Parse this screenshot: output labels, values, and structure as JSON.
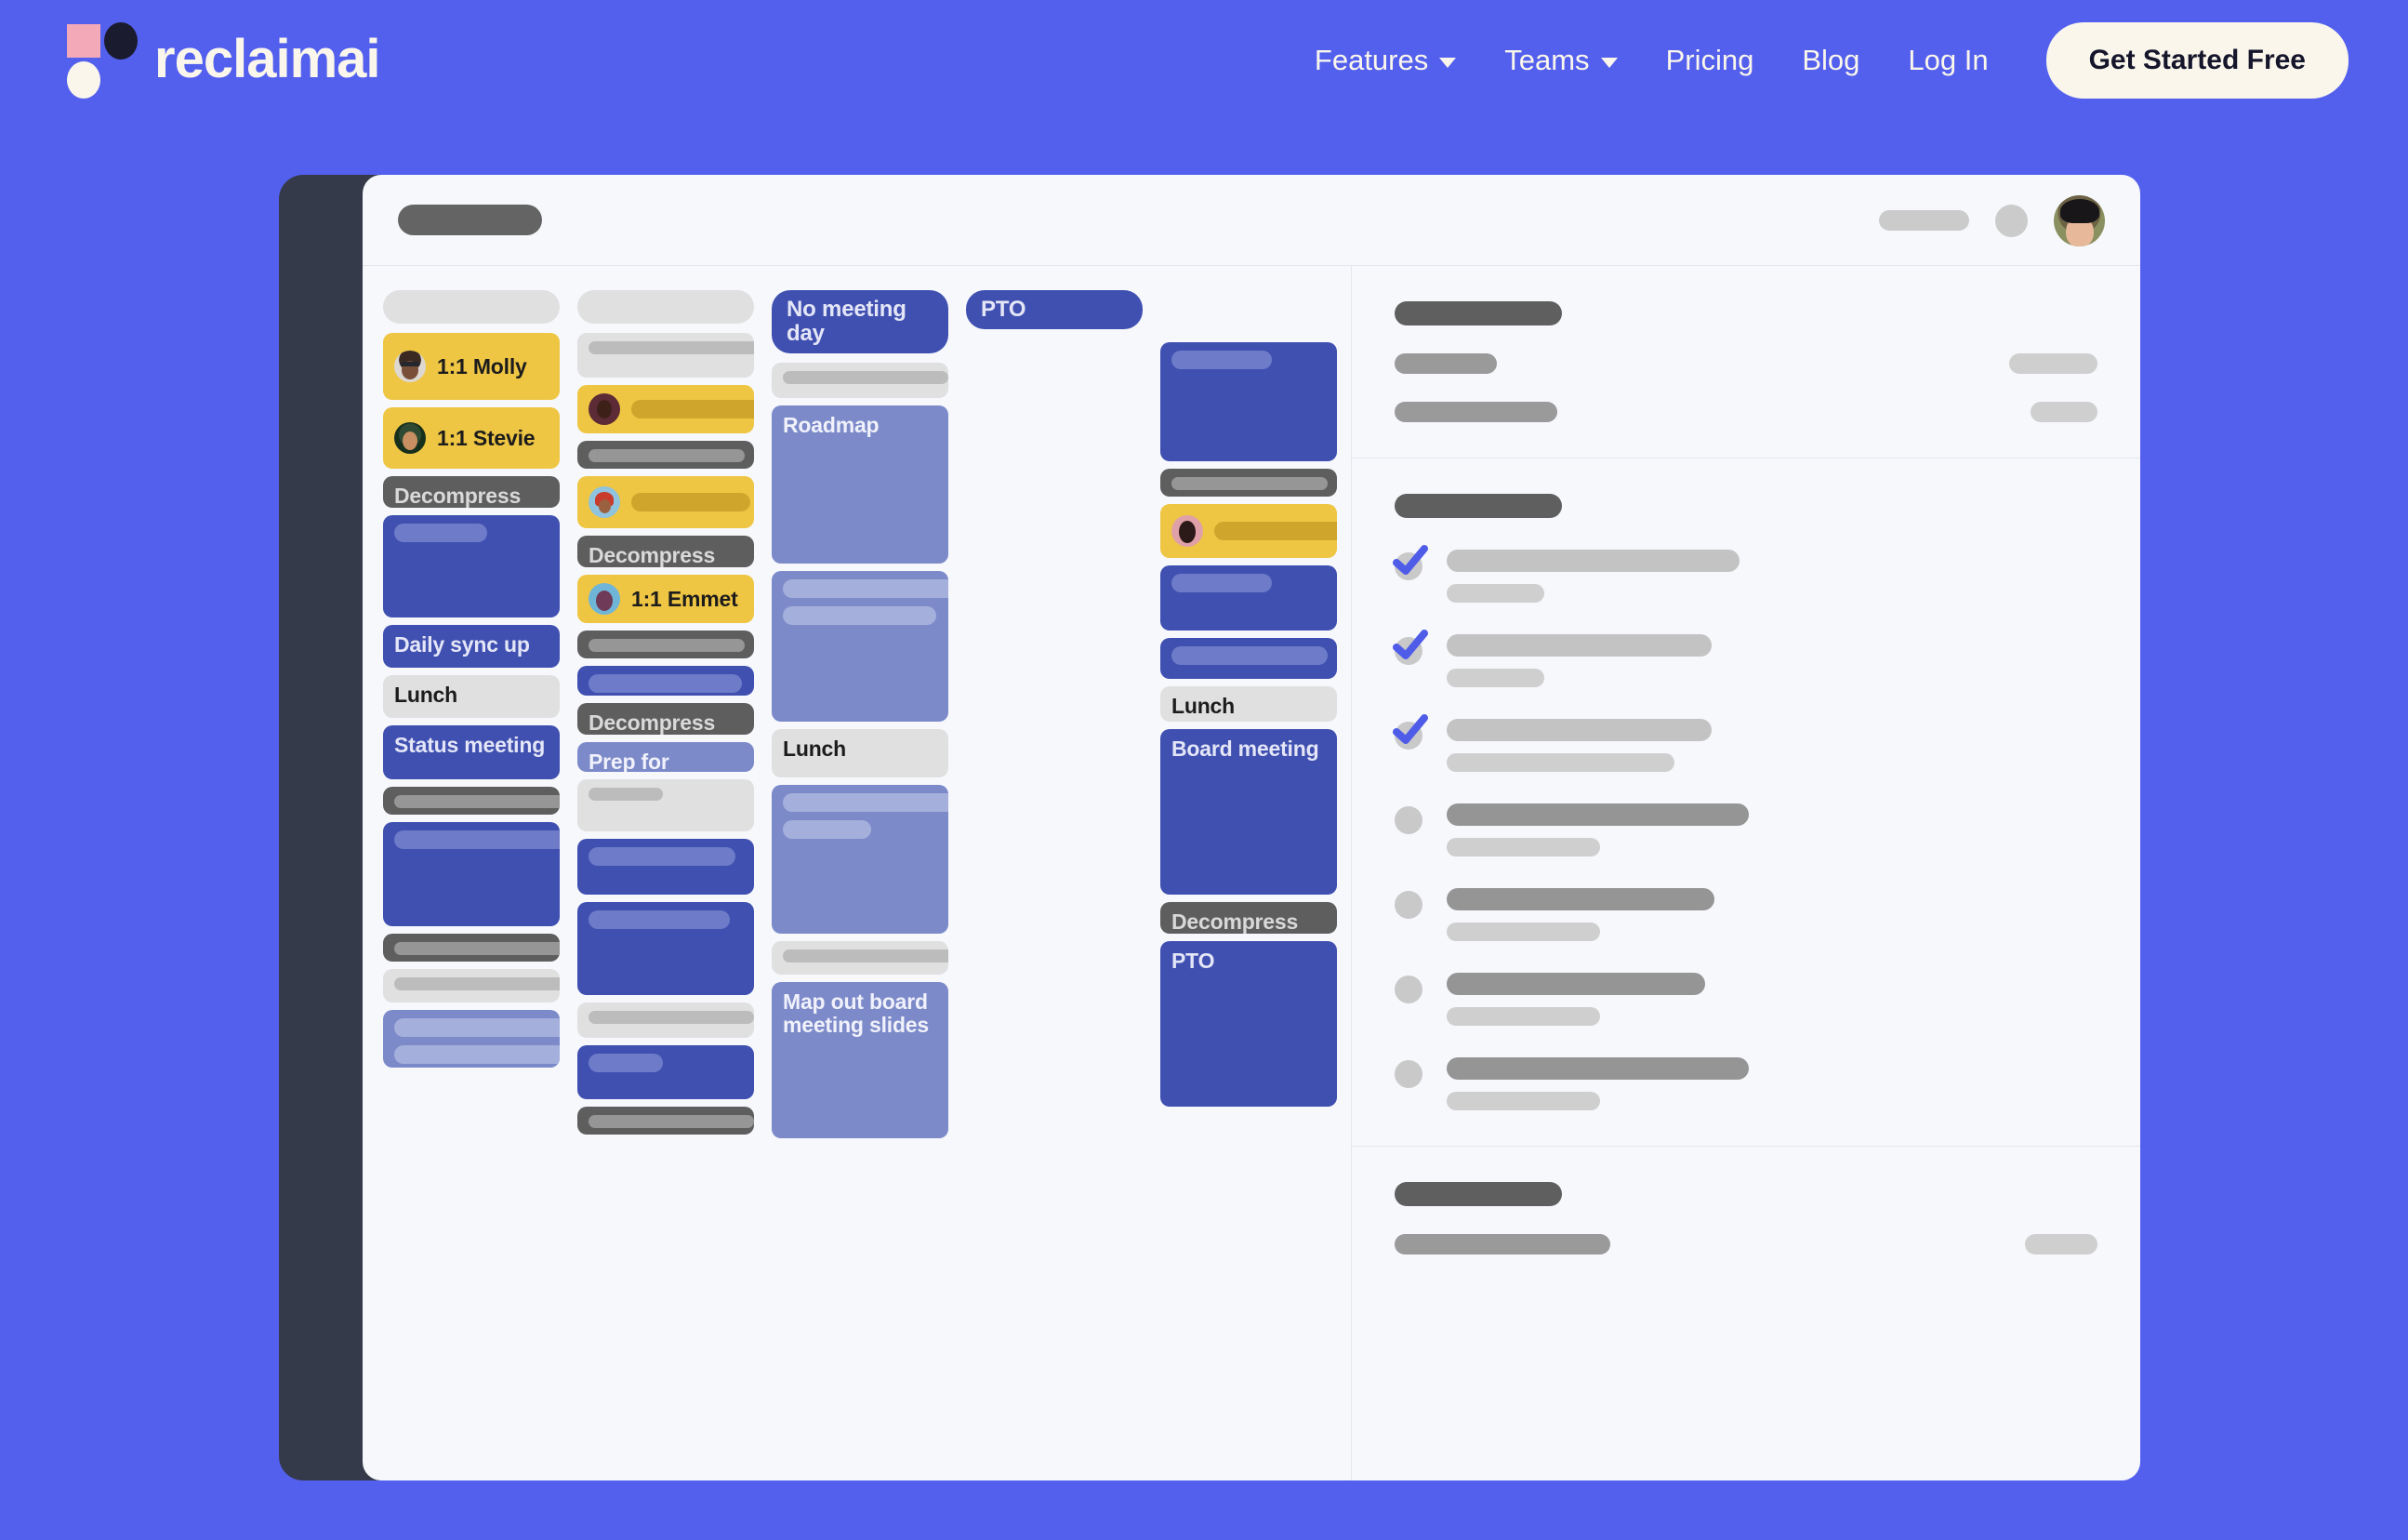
{
  "brand": {
    "name": "reclaimai",
    "logo_icon": "reclaim-logo-icon",
    "background_color": "#5360ED",
    "cream_color": "#FAF6EC"
  },
  "nav": {
    "items": [
      {
        "label": "Features",
        "has_dropdown": true,
        "icon": "chevron-down-icon"
      },
      {
        "label": "Teams",
        "has_dropdown": true,
        "icon": "chevron-down-icon"
      },
      {
        "label": "Pricing",
        "has_dropdown": false,
        "icon": ""
      },
      {
        "label": "Blog",
        "has_dropdown": false,
        "icon": ""
      },
      {
        "label": "Log In",
        "has_dropdown": false,
        "icon": ""
      }
    ],
    "cta_label": "Get Started Free"
  },
  "app": {
    "header": {
      "title_placeholder": "",
      "avatar_icon": "user-avatar"
    },
    "calendar": {
      "columns": [
        {
          "header": {
            "type": "skeleton",
            "style": "light"
          },
          "events": [
            {
              "label": "1:1 Molly",
              "type": "yellow",
              "avatar": "av-molly",
              "height": 72,
              "lines": []
            },
            {
              "label": "1:1 Stevie",
              "type": "yellow",
              "avatar": "av-stevie",
              "height": 66,
              "lines": []
            },
            {
              "label": "Decompress",
              "type": "gray",
              "avatar": "",
              "height": 34,
              "lines": []
            },
            {
              "label": "",
              "type": "blue",
              "avatar": "",
              "height": 110,
              "lines": [
                100
              ]
            },
            {
              "label": "Daily sync up",
              "type": "blue",
              "avatar": "",
              "height": 46,
              "lines": []
            },
            {
              "label": "Lunch",
              "type": "light",
              "avatar": "",
              "height": 46,
              "lines": []
            },
            {
              "label": "Status meeting",
              "type": "blue",
              "avatar": "",
              "height": 58,
              "lines": []
            },
            {
              "label": "",
              "type": "gray",
              "avatar": "",
              "height": 30,
              "lines": [
                190
              ]
            },
            {
              "label": "",
              "type": "blue",
              "avatar": "",
              "height": 112,
              "lines": [
                190
              ]
            },
            {
              "label": "",
              "type": "gray",
              "avatar": "",
              "height": 30,
              "lines": [
                190
              ]
            },
            {
              "label": "",
              "type": "light",
              "avatar": "",
              "height": 36,
              "lines": [
                190
              ]
            },
            {
              "label": "",
              "type": "lblue",
              "avatar": "",
              "height": 62,
              "lines": [
                190,
                185
              ]
            }
          ]
        },
        {
          "header": {
            "type": "skeleton",
            "style": "light"
          },
          "events": [
            {
              "label": "",
              "type": "light",
              "avatar": "",
              "height": 48,
              "lines": [
                190
              ]
            },
            {
              "label": "",
              "type": "yellow",
              "avatar": "av-dark",
              "height": 52,
              "lines": [
                172
              ]
            },
            {
              "label": "",
              "type": "gray",
              "avatar": "",
              "height": 30,
              "lines": [
                168
              ]
            },
            {
              "label": "",
              "type": "yellow",
              "avatar": "av-red",
              "height": 56,
              "lines": [
                128
              ]
            },
            {
              "label": "Decompress",
              "type": "gray",
              "avatar": "",
              "height": 34,
              "lines": []
            },
            {
              "label": "1:1 Emmet",
              "type": "yellow",
              "avatar": "av-emmet",
              "height": 52,
              "lines": []
            },
            {
              "label": "",
              "type": "gray",
              "avatar": "",
              "height": 30,
              "lines": [
                168
              ]
            },
            {
              "label": "",
              "type": "blue",
              "avatar": "",
              "height": 32,
              "lines": [
                165
              ]
            },
            {
              "label": "Decompress",
              "type": "gray",
              "avatar": "",
              "height": 34,
              "lines": []
            },
            {
              "label": "Prep for strategy review",
              "type": "lblue",
              "avatar": "",
              "height": 32,
              "lines": []
            },
            {
              "label": "",
              "type": "light",
              "avatar": "",
              "height": 56,
              "lines": [
                80
              ]
            },
            {
              "label": "",
              "type": "blue",
              "avatar": "",
              "height": 60,
              "lines": [
                158
              ]
            },
            {
              "label": "",
              "type": "blue",
              "avatar": "",
              "height": 100,
              "lines": [
                152
              ]
            },
            {
              "label": "",
              "type": "light",
              "avatar": "",
              "height": 38,
              "lines": [
                178
              ]
            },
            {
              "label": "",
              "type": "blue",
              "avatar": "",
              "height": 58,
              "lines": [
                80
              ]
            },
            {
              "label": "",
              "type": "gray",
              "avatar": "",
              "height": 30,
              "lines": [
                178
              ]
            }
          ]
        },
        {
          "header": {
            "type": "pill",
            "label": "No meeting day",
            "style": "blue"
          },
          "events": [
            {
              "label": "",
              "type": "light",
              "avatar": "",
              "height": 38,
              "lines": [
                178
              ]
            },
            {
              "label": "Roadmap",
              "type": "lblue",
              "avatar": "",
              "height": 170,
              "lines": []
            },
            {
              "label": "",
              "type": "lblue",
              "avatar": "",
              "height": 162,
              "lines": [
                190,
                165
              ]
            },
            {
              "label": "Lunch",
              "type": "light",
              "avatar": "",
              "height": 52,
              "lines": []
            },
            {
              "label": "",
              "type": "lblue",
              "avatar": "",
              "height": 160,
              "lines": [
                190,
                95
              ]
            },
            {
              "label": "",
              "type": "light",
              "avatar": "",
              "height": 36,
              "lines": [
                190
              ]
            },
            {
              "label": "Map out board meeting slides",
              "type": "lblue",
              "avatar": "",
              "height": 168,
              "lines": []
            }
          ]
        },
        {
          "header": {
            "type": "pill",
            "label": "PTO",
            "style": "blue"
          },
          "events": []
        },
        {
          "header": {
            "type": "none",
            "label": "",
            "style": ""
          },
          "events": [
            {
              "label": "",
              "type": "blue",
              "avatar": "",
              "height": 128,
              "lines": [
                108
              ]
            },
            {
              "label": "",
              "type": "gray",
              "avatar": "",
              "height": 30,
              "lines": [
                168
              ]
            },
            {
              "label": "",
              "type": "yellow",
              "avatar": "av-pink",
              "height": 58,
              "lines": [
                172
              ]
            },
            {
              "label": "",
              "type": "blue",
              "avatar": "",
              "height": 70,
              "lines": [
                108
              ]
            },
            {
              "label": "",
              "type": "blue",
              "avatar": "",
              "height": 44,
              "lines": [
                168
              ]
            },
            {
              "label": "Lunch",
              "type": "light",
              "avatar": "",
              "height": 38,
              "lines": []
            },
            {
              "label": "Board meeting",
              "type": "blue",
              "avatar": "",
              "height": 178,
              "lines": []
            },
            {
              "label": "Decompress",
              "type": "gray",
              "avatar": "",
              "height": 34,
              "lines": []
            },
            {
              "label": "PTO",
              "type": "blue",
              "avatar": "",
              "height": 178,
              "lines": []
            }
          ]
        }
      ]
    },
    "sidebar": {
      "sections": [
        {
          "id": "stats",
          "title_placeholder": "",
          "rows": [
            {
              "left_width": 110,
              "right_width": 95
            },
            {
              "left_width": 175,
              "right_width": 72
            }
          ]
        },
        {
          "id": "tasks",
          "title_placeholder": "",
          "tasks": [
            {
              "done": true,
              "line1_width": 315,
              "line2_width": 105
            },
            {
              "done": true,
              "line1_width": 285,
              "line2_width": 105
            },
            {
              "done": true,
              "line1_width": 285,
              "line2_width": 245
            },
            {
              "done": false,
              "line1_width": 325,
              "line2_width": 165
            },
            {
              "done": false,
              "line1_width": 288,
              "line2_width": 165
            },
            {
              "done": false,
              "line1_width": 278,
              "line2_width": 165
            },
            {
              "done": false,
              "line1_width": 325,
              "line2_width": 165
            }
          ]
        },
        {
          "id": "footer",
          "title_placeholder": "",
          "rows": [
            {
              "left_width": 232,
              "right_width": 78
            }
          ]
        }
      ]
    }
  },
  "colors": {
    "accent_blue": "#5360ED",
    "event_blue": "#4050B0",
    "event_light_blue": "#7C8AC9",
    "event_yellow": "#EFC643",
    "event_gray": "#5E5E5E",
    "event_light": "#E0E0E0",
    "app_bg": "#F6F8FC",
    "window_frame": "#343A49"
  }
}
